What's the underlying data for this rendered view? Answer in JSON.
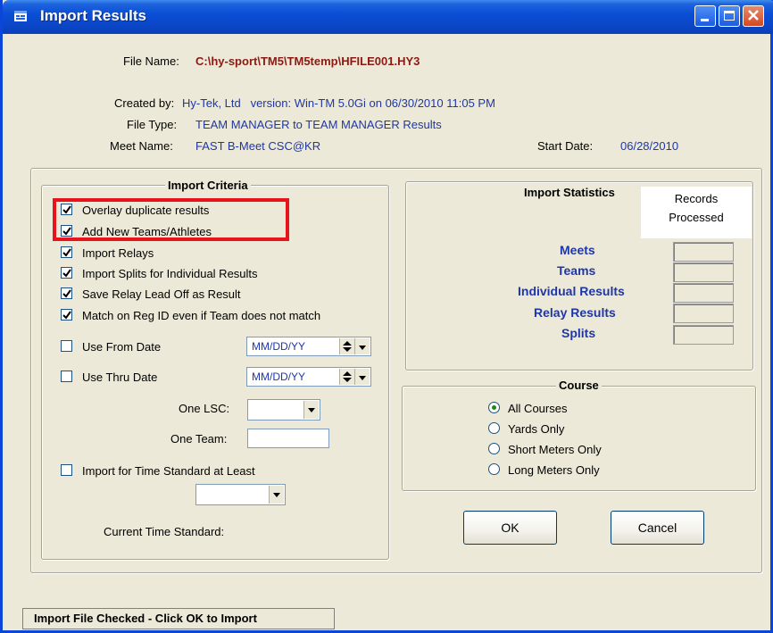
{
  "window": {
    "title": "Import Results"
  },
  "file_info": {
    "file_name_label": "File Name:",
    "file_name_value": "C:\\hy-sport\\TM5\\TM5temp\\HFILE001.HY3",
    "created_by_label": "Created by:",
    "created_by_value": "Hy-Tek, Ltd   version: Win-TM 5.0Gi on 06/30/2010 11:05 PM",
    "file_type_label": "File Type:",
    "file_type_value": "TEAM MANAGER to TEAM MANAGER Results",
    "meet_name_label": "Meet Name:",
    "meet_name_value": "FAST B-Meet CSC@KR",
    "start_date_label": "Start Date:",
    "start_date_value": "06/28/2010"
  },
  "criteria": {
    "legend": "Import Criteria",
    "checks": [
      {
        "label": "Overlay duplicate results",
        "checked": true
      },
      {
        "label": "Add New Teams/Athletes",
        "checked": true
      },
      {
        "label": "Import Relays",
        "checked": true
      },
      {
        "label": "Import Splits for Individual Results",
        "checked": true
      },
      {
        "label": "Save Relay Lead Off as Result",
        "checked": true
      },
      {
        "label": "Match on Reg ID even if Team does not match",
        "checked": true
      }
    ],
    "use_from_date_label": "Use From Date",
    "use_from_date_value": "MM/DD/YY",
    "use_thru_date_label": "Use Thru Date",
    "use_thru_date_value": "MM/DD/YY",
    "one_lsc_label": "One LSC:",
    "one_team_label": "One Team:",
    "time_standard_label": "Import for Time Standard at Least",
    "current_time_standard_label": "Current Time Standard:"
  },
  "statistics": {
    "legend": "Import Statistics",
    "records_header": "Records\nProcessed",
    "rows": [
      "Meets",
      "Teams",
      "Individual Results",
      "Relay Results",
      "Splits"
    ]
  },
  "course": {
    "legend": "Course",
    "options": [
      {
        "label": "All Courses",
        "selected": true
      },
      {
        "label": "Yards Only",
        "selected": false
      },
      {
        "label": "Short Meters Only",
        "selected": false
      },
      {
        "label": "Long Meters Only",
        "selected": false
      }
    ]
  },
  "buttons": {
    "ok": "OK",
    "cancel": "Cancel"
  },
  "status_bar": "Import File Checked - Click OK to Import",
  "colors": {
    "title_bar": "#0a4fd6",
    "highlight_box": "#e8141c",
    "label_blue": "#1f37a6",
    "path_red": "#8b1a12"
  }
}
